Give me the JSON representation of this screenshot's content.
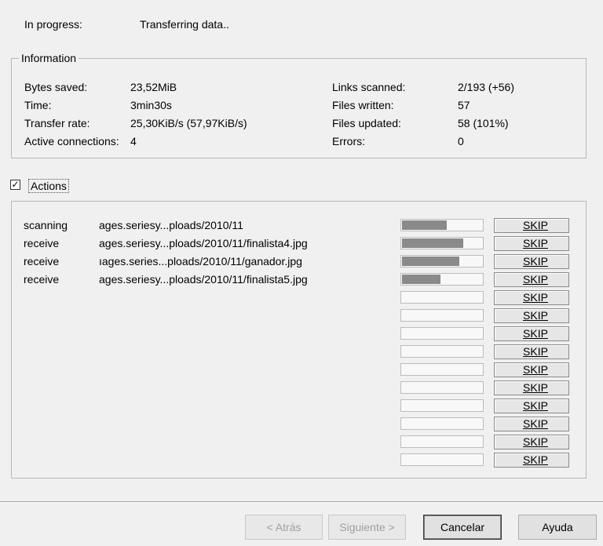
{
  "status": {
    "label": "In progress:",
    "value": "Transferring data.."
  },
  "information": {
    "legend": "Information",
    "left": [
      {
        "label": "Bytes saved:",
        "value": "23,52MiB"
      },
      {
        "label": "Time:",
        "value": "3min30s"
      },
      {
        "label": "Transfer rate:",
        "value": "25,30KiB/s (57,97KiB/s)"
      },
      {
        "label": "Active connections:",
        "value": "4"
      }
    ],
    "right": [
      {
        "label": "Links scanned:",
        "value": "2/193 (+56)"
      },
      {
        "label": "Files written:",
        "value": "57"
      },
      {
        "label": "Files updated:",
        "value": "58 (101%)"
      },
      {
        "label": "Errors:",
        "value": "0"
      }
    ]
  },
  "actions": {
    "checkbox_label": "Actions",
    "checked": true,
    "skip_label": "SKIP",
    "rows": [
      {
        "type": "scanning",
        "url": "ages.seriesy...ploads/2010/11",
        "progress": 0.55
      },
      {
        "type": "receive",
        "url": "ages.seriesy...ploads/2010/11/finalista4.jpg",
        "progress": 0.75
      },
      {
        "type": "receive",
        "url": "ıages.series...ploads/2010/11/ganador.jpg",
        "progress": 0.7
      },
      {
        "type": "receive",
        "url": "ages.seriesy...ploads/2010/11/finalista5.jpg",
        "progress": 0.47
      },
      {
        "type": "",
        "url": "",
        "progress": 0
      },
      {
        "type": "",
        "url": "",
        "progress": 0
      },
      {
        "type": "",
        "url": "",
        "progress": 0
      },
      {
        "type": "",
        "url": "",
        "progress": 0
      },
      {
        "type": "",
        "url": "",
        "progress": 0
      },
      {
        "type": "",
        "url": "",
        "progress": 0
      },
      {
        "type": "",
        "url": "",
        "progress": 0
      },
      {
        "type": "",
        "url": "",
        "progress": 0
      },
      {
        "type": "",
        "url": "",
        "progress": 0
      },
      {
        "type": "",
        "url": "",
        "progress": 0
      }
    ]
  },
  "buttons": {
    "back": "< Atrás",
    "next": "Siguiente >",
    "cancel": "Cancelar",
    "help": "Ayuda"
  }
}
